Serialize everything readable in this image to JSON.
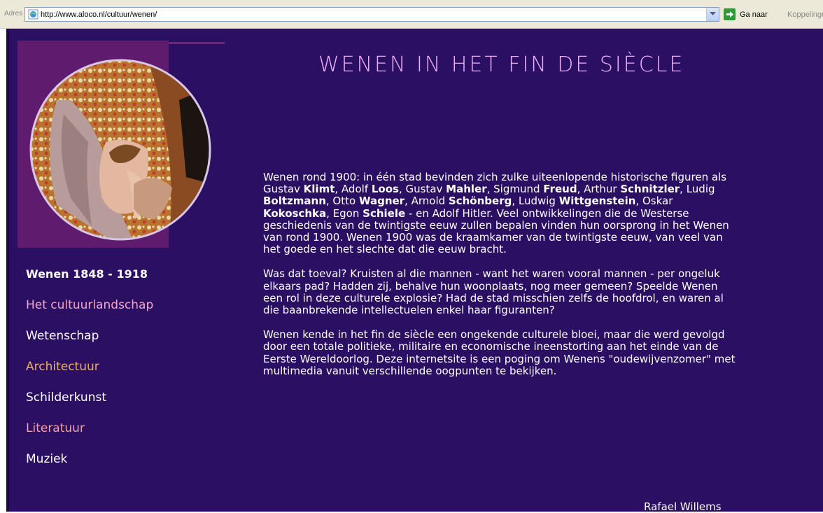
{
  "browser": {
    "address_label": "Adres",
    "url": "http://www.aloco.nl/cultuur/wenen/",
    "go_label": "Ga naar",
    "links_label": "Koppelingen"
  },
  "page": {
    "heading": "WENEN IN HET FIN DE SIÈCLE",
    "nav": {
      "title": "Wenen 1848 - 1918",
      "items": [
        {
          "label": "Het cultuurlandschap",
          "color": "#f3a6c6"
        },
        {
          "label": "Wetenschap",
          "color": "#ffffff"
        },
        {
          "label": "Architectuur",
          "color": "#e8ad6b"
        },
        {
          "label": "Schilderkunst",
          "color": "#ffffff"
        },
        {
          "label": "Literatuur",
          "color": "#f6a1a6"
        },
        {
          "label": "Muziek",
          "color": "#ffffff"
        }
      ]
    },
    "paragraphs": {
      "p1": [
        {
          "t": "Wenen rond 1900: in één stad bevinden zich zulke uiteenlopende historische figuren als Gustav "
        },
        {
          "t": "Klimt",
          "b": true
        },
        {
          "t": ", Adolf "
        },
        {
          "t": "Loos",
          "b": true
        },
        {
          "t": ", Gustav "
        },
        {
          "t": "Mahler",
          "b": true
        },
        {
          "t": ", Sigmund "
        },
        {
          "t": "Freud",
          "b": true
        },
        {
          "t": ", Arthur "
        },
        {
          "t": "Schnitzler",
          "b": true
        },
        {
          "t": ", Ludig "
        },
        {
          "t": "Boltzmann",
          "b": true
        },
        {
          "t": ", Otto "
        },
        {
          "t": "Wagner",
          "b": true
        },
        {
          "t": ", Arnold "
        },
        {
          "t": "Schönberg",
          "b": true
        },
        {
          "t": ", Ludwig "
        },
        {
          "t": "Wittgenstein",
          "b": true
        },
        {
          "t": ", Oskar "
        },
        {
          "t": "Kokoschka",
          "b": true
        },
        {
          "t": ", Egon "
        },
        {
          "t": "Schiele",
          "b": true
        },
        {
          "t": " - en Adolf Hitler. Veel ontwikkelingen die de Westerse geschiedenis van de twintigste eeuw zullen bepalen vinden hun oorsprong in het Wenen van rond 1900. Wenen 1900 was de kraamkamer van de twintigste eeuw, van veel van het goede en het slechte dat die eeuw bracht."
        }
      ],
      "p2": "Was dat toeval? Kruisten al die mannen - want het waren vooral mannen - per ongeluk elkaars pad? Hadden zij, behalve hun woonplaats, nog meer gemeen? Speelde Wenen een rol in deze culturele explosie? Had de stad misschien zelfs de hoofdrol, en waren al die baanbrekende intellectuelen enkel haar figuranten?",
      "p3": "Wenen kende in het fin de siècle een ongekende culturele bloei, maar die werd gevolgd door een totale politieke, militaire en economische ineenstorting aan het einde van de Eerste Wereldoorlog. Deze internetsite is een poging om Wenens \"oudewijvenzomer\" met multimedia vanuit verschillende oogpunten te bekijken."
    },
    "signature": "Rafael Willems"
  },
  "colors": {
    "background": "#2a0f63",
    "panel": "#5f1c6e",
    "heading": "#eeaefa"
  }
}
